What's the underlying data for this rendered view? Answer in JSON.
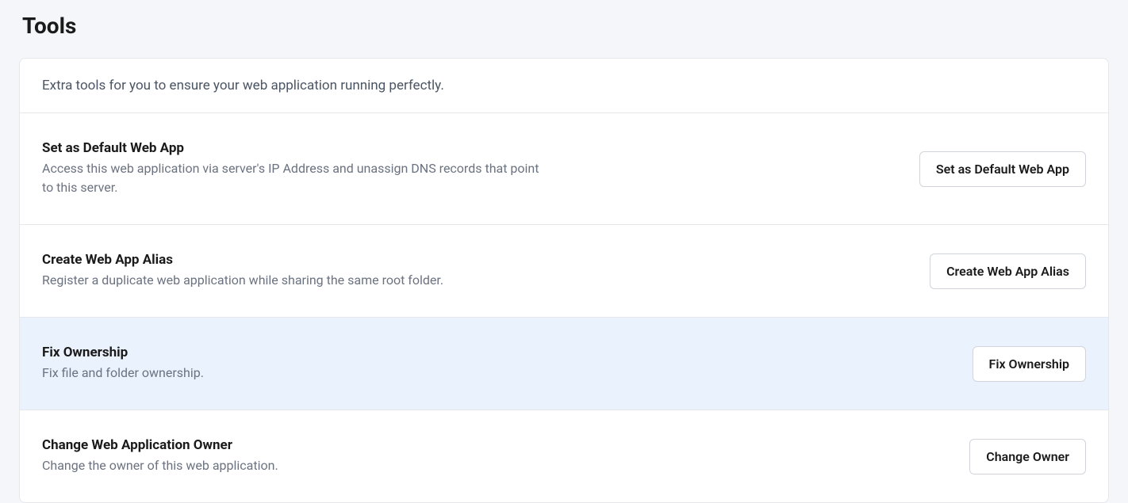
{
  "page": {
    "title": "Tools",
    "intro": "Extra tools for you to ensure your web application running perfectly."
  },
  "tools": [
    {
      "title": "Set as Default Web App",
      "desc": "Access this web application via server's IP Address and unassign DNS records that point to this server.",
      "button": "Set as Default Web App",
      "highlight": false
    },
    {
      "title": "Create Web App Alias",
      "desc": "Register a duplicate web application while sharing the same root folder.",
      "button": "Create Web App Alias",
      "highlight": false
    },
    {
      "title": "Fix Ownership",
      "desc": "Fix file and folder ownership.",
      "button": "Fix Ownership",
      "highlight": true
    },
    {
      "title": "Change Web Application Owner",
      "desc": "Change the owner of this web application.",
      "button": "Change Owner",
      "highlight": false
    }
  ]
}
